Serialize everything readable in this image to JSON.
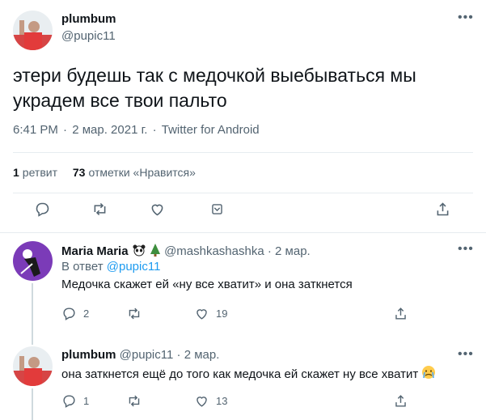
{
  "main_tweet": {
    "name": "plumbum",
    "handle": "@pupic11",
    "text": "этери будешь так с медочкой выебываться мы украдем все твои пальто",
    "time": "6:41 PM",
    "date": "2 мар. 2021 г.",
    "sep": "·",
    "source": "Twitter for Android",
    "retweets_count": "1",
    "retweets_label": "ретвит",
    "likes_count": "73",
    "likes_label": "отметки «Нравится»"
  },
  "replies": [
    {
      "name": "Maria Maria",
      "handle": "@mashkashashka",
      "sep": "·",
      "date": "2 мар.",
      "reply_to_label": "В ответ",
      "reply_to_handle": "@pupic11",
      "text": "Медочка скажет ей «ну все хватит» и она заткнется",
      "reply_count": "2",
      "retweet_count": "",
      "like_count": "19"
    },
    {
      "name": "plumbum",
      "handle": "@pupic11",
      "sep": "·",
      "date": "2 мар.",
      "text": "она заткнется ещё до того как медочка ей скажет ну все хватит",
      "reply_count": "1",
      "retweet_count": "",
      "like_count": "13"
    }
  ],
  "icons": {
    "reply": "reply-icon",
    "retweet": "retweet-icon",
    "like": "heart-icon",
    "share": "share-icon",
    "more": "more-icon",
    "bookmark": "bookmark-icon"
  },
  "colors": {
    "link": "#1d9bf0",
    "secondary_text": "#536471",
    "divider": "#e6ecf0"
  }
}
